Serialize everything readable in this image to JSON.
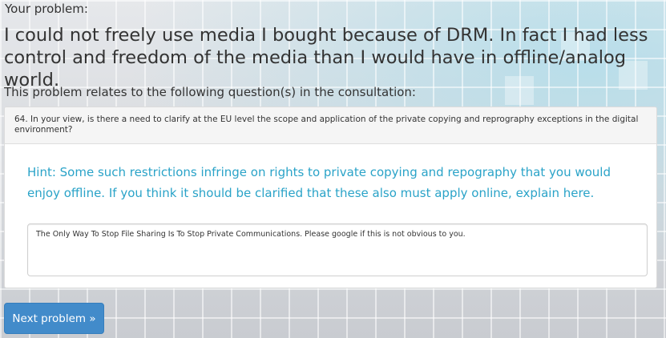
{
  "intro_label": "Your problem:",
  "problem_title": "I could not freely use media I bought because of DRM. In fact I had less control and freedom of the media than I would have in offline/analog world.",
  "relates_label": "This problem relates to the following question(s) in the consultation:",
  "question": {
    "heading": "64. In your view, is there a need to clarify at the EU level the scope and application of the private copying and reprography exceptions in the digital environment?",
    "hint": "Hint: Some such restrictions infringe on rights to private copying and repography that you would enjoy offline. If you think it should be clarified that these also must apply online, explain here.",
    "answer_value": "The Only Way To Stop File Sharing Is To Stop Private Communications. Please google if this is not obvious to you."
  },
  "next_button_label": "Next problem »",
  "colors": {
    "hint": "#2aa3c8",
    "button": "#428bca",
    "text": "#333333"
  }
}
